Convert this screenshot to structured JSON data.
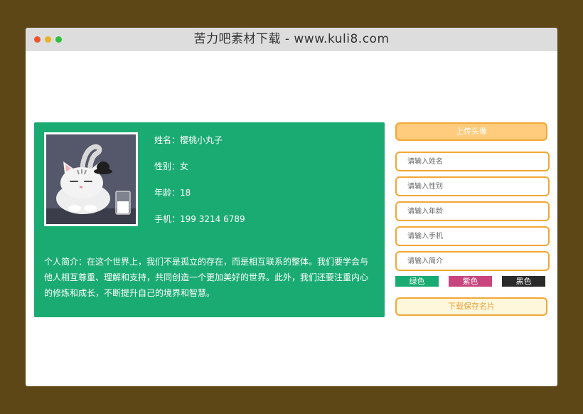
{
  "window": {
    "title": "苦力吧素材下载 - www.kuli8.com"
  },
  "card": {
    "name_line": "姓名：樱桃小丸子",
    "gender_line": "性别：女",
    "age_line": "年龄：18",
    "phone_line": "手机：199 3214 6789",
    "bio": "个人简介：在这个世界上，我们不是孤立的存在，而是相互联系的整体。我们要学会与他人相互尊重、理解和支持，共同创造一个更加美好的世界。此外，我们还要注重内心的修炼和成长，不断提升自己的境界和智慧。"
  },
  "form": {
    "upload_label": "上传头像",
    "name_placeholder": "请输入姓名",
    "gender_placeholder": "请输入性别",
    "age_placeholder": "请输入年龄",
    "phone_placeholder": "请输入手机",
    "bio_placeholder": "请输入简介",
    "swatches": [
      {
        "label": "绿色",
        "color": "#1aab73"
      },
      {
        "label": "紫色",
        "color": "#c9457e"
      },
      {
        "label": "黑色",
        "color": "#2a2a2a"
      }
    ],
    "download_label": "下载保存名片"
  },
  "colors": {
    "card_green": "#1aab73",
    "accent_orange": "#f2a735",
    "upload_fill": "#ffcb7c",
    "page_bg": "#5e4716"
  }
}
